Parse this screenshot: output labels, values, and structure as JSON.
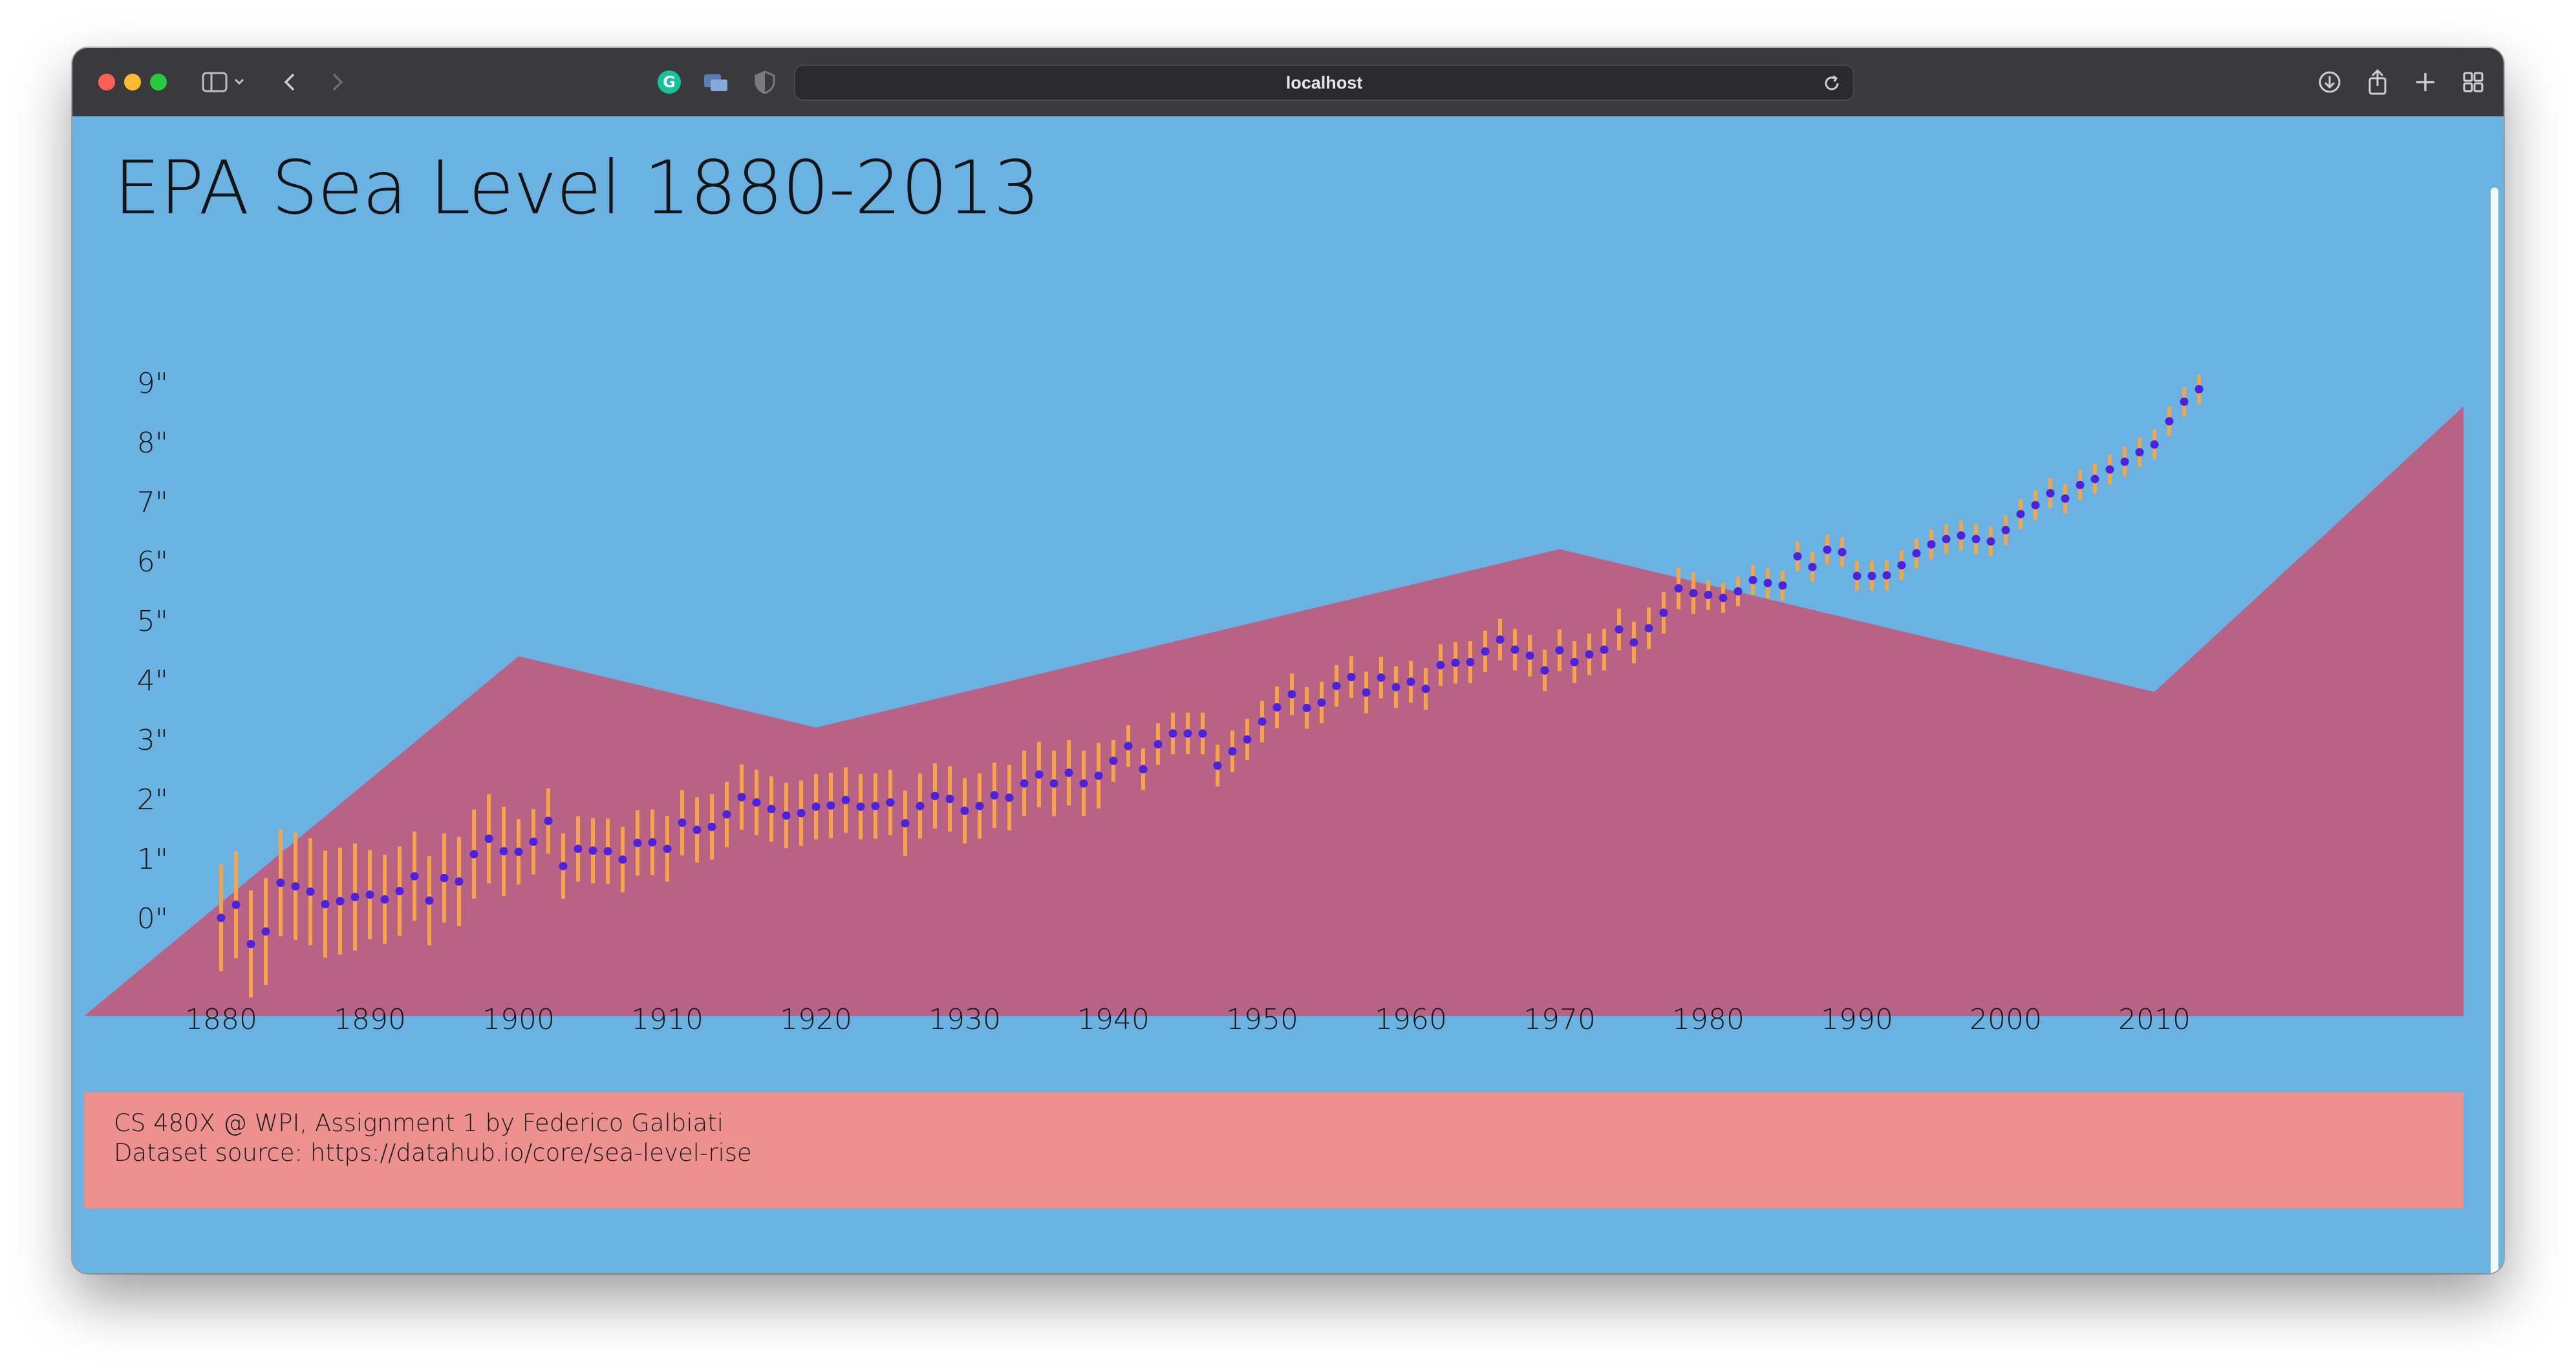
{
  "browser": {
    "url": "localhost",
    "icons": {
      "sidebar": "sidebar-icon",
      "back": "chevron-left-icon",
      "forward": "chevron-right-icon",
      "grammarly": "grammarly-icon",
      "tabs": "tab-overview-icon",
      "privacy": "shield-icon",
      "reload": "reload-icon",
      "download": "download-icon",
      "share": "share-icon",
      "new_tab": "plus-icon",
      "grid": "grid-icon"
    }
  },
  "page": {
    "title": "EPA Sea Level 1880-2013",
    "footer_line1": "CS 480X @ WPI, Assignment 1 by Federico Galbiati",
    "footer_line2": "Dataset source: https://datahub.io/core/sea-level-rise"
  },
  "chart_data": {
    "type": "scatter",
    "title": "",
    "xlabel": "",
    "ylabel": "",
    "x_ticks": [
      "1880",
      "1890",
      "1900",
      "1910",
      "1920",
      "1930",
      "1940",
      "1950",
      "1960",
      "1970",
      "1980",
      "1990",
      "2000",
      "2010"
    ],
    "y_ticks": [
      "0\"",
      "1\"",
      "2\"",
      "3\"",
      "4\"",
      "5\"",
      "6\"",
      "7\"",
      "8\"",
      "9\""
    ],
    "xlim": [
      1870,
      2030
    ],
    "ylim": [
      0,
      9
    ],
    "colors": {
      "point": "#4a22e0",
      "error_bar": "#f5a547",
      "area": "#b86285",
      "background": "#6ab2e2",
      "footer": "#ec918d"
    },
    "area_series": {
      "x": [
        1870,
        1900,
        1920,
        1970,
        2010,
        2030
      ],
      "y": [
        -2.5,
        4.4,
        3.2,
        6.2,
        3.8,
        8.6
      ]
    },
    "series": [
      {
        "x": [
          1880,
          1881,
          1882,
          1883,
          1884,
          1885,
          1886,
          1887,
          1888,
          1889,
          1890,
          1891,
          1892,
          1893,
          1894,
          1895,
          1896,
          1897,
          1898,
          1899,
          1900,
          1901,
          1902,
          1903,
          1904,
          1905,
          1906,
          1907,
          1908,
          1909,
          1910,
          1911,
          1912,
          1913,
          1914,
          1915,
          1916,
          1917,
          1918,
          1919,
          1920,
          1921,
          1922,
          1923,
          1924,
          1925,
          1926,
          1927,
          1928,
          1929,
          1930,
          1931,
          1932,
          1933,
          1934,
          1935,
          1936,
          1937,
          1938,
          1939,
          1940,
          1941,
          1942,
          1943,
          1944,
          1945,
          1946,
          1947,
          1948,
          1949,
          1950,
          1951,
          1952,
          1953,
          1954,
          1955,
          1956,
          1957,
          1958,
          1959,
          1960,
          1961,
          1962,
          1963,
          1964,
          1965,
          1966,
          1967,
          1968,
          1969,
          1970,
          1971,
          1972,
          1973,
          1974,
          1975,
          1976,
          1977,
          1978,
          1979,
          1980,
          1981,
          1982,
          1983,
          1984,
          1985,
          1986,
          1987,
          1988,
          1989,
          1990,
          1991,
          1992,
          1993,
          1994,
          1995,
          1996,
          1997,
          1998,
          1999,
          2000,
          2001,
          2002,
          2003,
          2004,
          2005,
          2006,
          2007,
          2008,
          2009,
          2010,
          2011,
          2012,
          2013
        ],
        "y": [
          0.0,
          0.22,
          -0.44,
          -0.23,
          0.59,
          0.53,
          0.44,
          0.23,
          0.28,
          0.35,
          0.39,
          0.31,
          0.45,
          0.7,
          0.29,
          0.67,
          0.61,
          1.07,
          1.33,
          1.12,
          1.11,
          1.28,
          1.63,
          0.87,
          1.16,
          1.13,
          1.12,
          0.98,
          1.26,
          1.27,
          1.16,
          1.6,
          1.48,
          1.53,
          1.74,
          2.03,
          1.94,
          1.83,
          1.72,
          1.76,
          1.87,
          1.89,
          1.98,
          1.87,
          1.88,
          1.94,
          1.59,
          1.88,
          2.05,
          2.0,
          1.8,
          1.88,
          2.06,
          2.02,
          2.26,
          2.41,
          2.26,
          2.44,
          2.26,
          2.39,
          2.64,
          2.89,
          2.5,
          2.92,
          3.1,
          3.1,
          3.1,
          2.56,
          2.8,
          3.0,
          3.3,
          3.54,
          3.76,
          3.53,
          3.62,
          3.9,
          4.05,
          3.79,
          4.04,
          3.88,
          3.97,
          3.85,
          4.25,
          4.29,
          4.3,
          4.48,
          4.68,
          4.51,
          4.41,
          4.16,
          4.5,
          4.3,
          4.43,
          4.51,
          4.85,
          4.63,
          4.87,
          5.13,
          5.54,
          5.46,
          5.43,
          5.38,
          5.49,
          5.68,
          5.63,
          5.59,
          6.08,
          5.9,
          6.19,
          6.15,
          5.75,
          5.75,
          5.76,
          5.93,
          6.13,
          6.28,
          6.37,
          6.43,
          6.37,
          6.33,
          6.52,
          6.79,
          6.94,
          7.14,
          7.05,
          7.28,
          7.38,
          7.54,
          7.67,
          7.83,
          7.96,
          8.35,
          8.68,
          8.89
        ]
      }
    ]
  }
}
